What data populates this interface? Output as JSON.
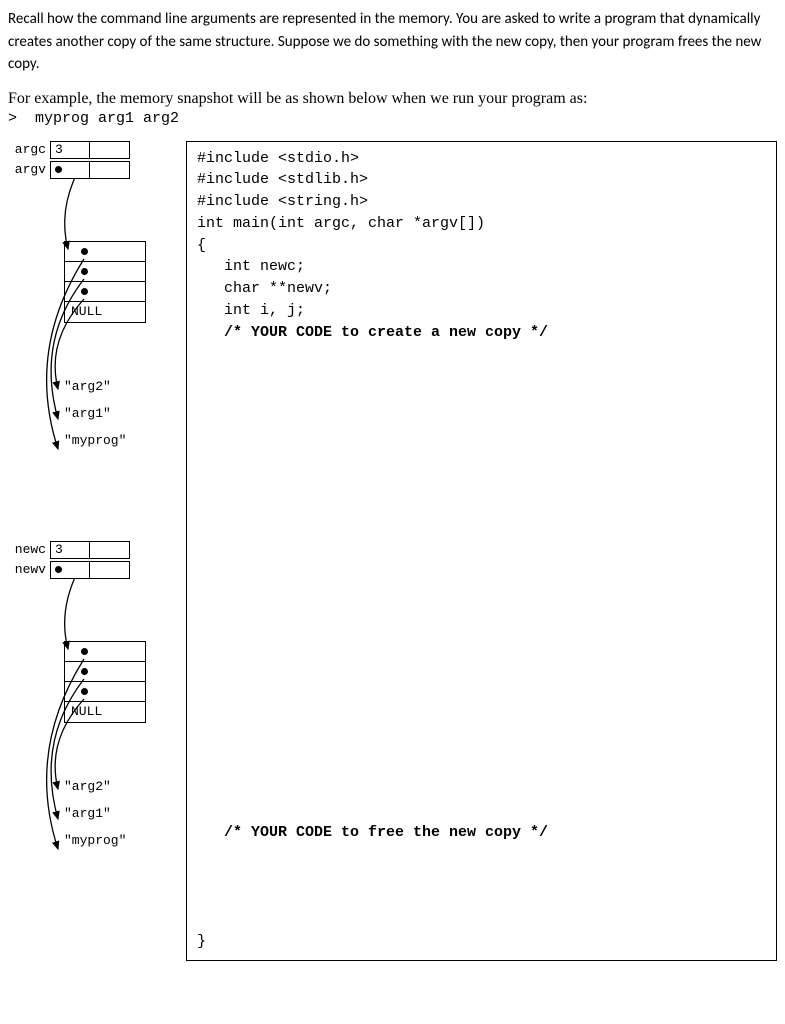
{
  "intro": {
    "p1": "Recall how the command line arguments are represented in the memory. You are asked to write a program that dynamically creates another copy of the same structure. Suppose we do something with the new copy, then your program frees the new copy.",
    "example": "For example, the memory snapshot will be as shown below when we run your program as:",
    "cmd_prompt": ">",
    "cmd": "myprog arg1 arg2"
  },
  "diagram": {
    "argc_label": "argc",
    "argc_value": "3",
    "argv_label": "argv",
    "null_label": "NULL",
    "str_arg2": "\"arg2\"",
    "str_arg1": "\"arg1\"",
    "str_myprog": "\"myprog\"",
    "newc_label": "newc",
    "newc_value": "3",
    "newv_label": "newv"
  },
  "code": {
    "l1": "#include <stdio.h>",
    "l2": "#include <stdlib.h>",
    "l3": "#include <string.h>",
    "l4": "int main(int argc, char *argv[])",
    "l5": "{",
    "l6": "   int newc;",
    "l7": "   char **newv;",
    "l8": "   int i, j;",
    "l9": "   /* YOUR CODE to create a new copy */",
    "l10": "   /* YOUR CODE to free the new copy */",
    "l11": "}"
  }
}
